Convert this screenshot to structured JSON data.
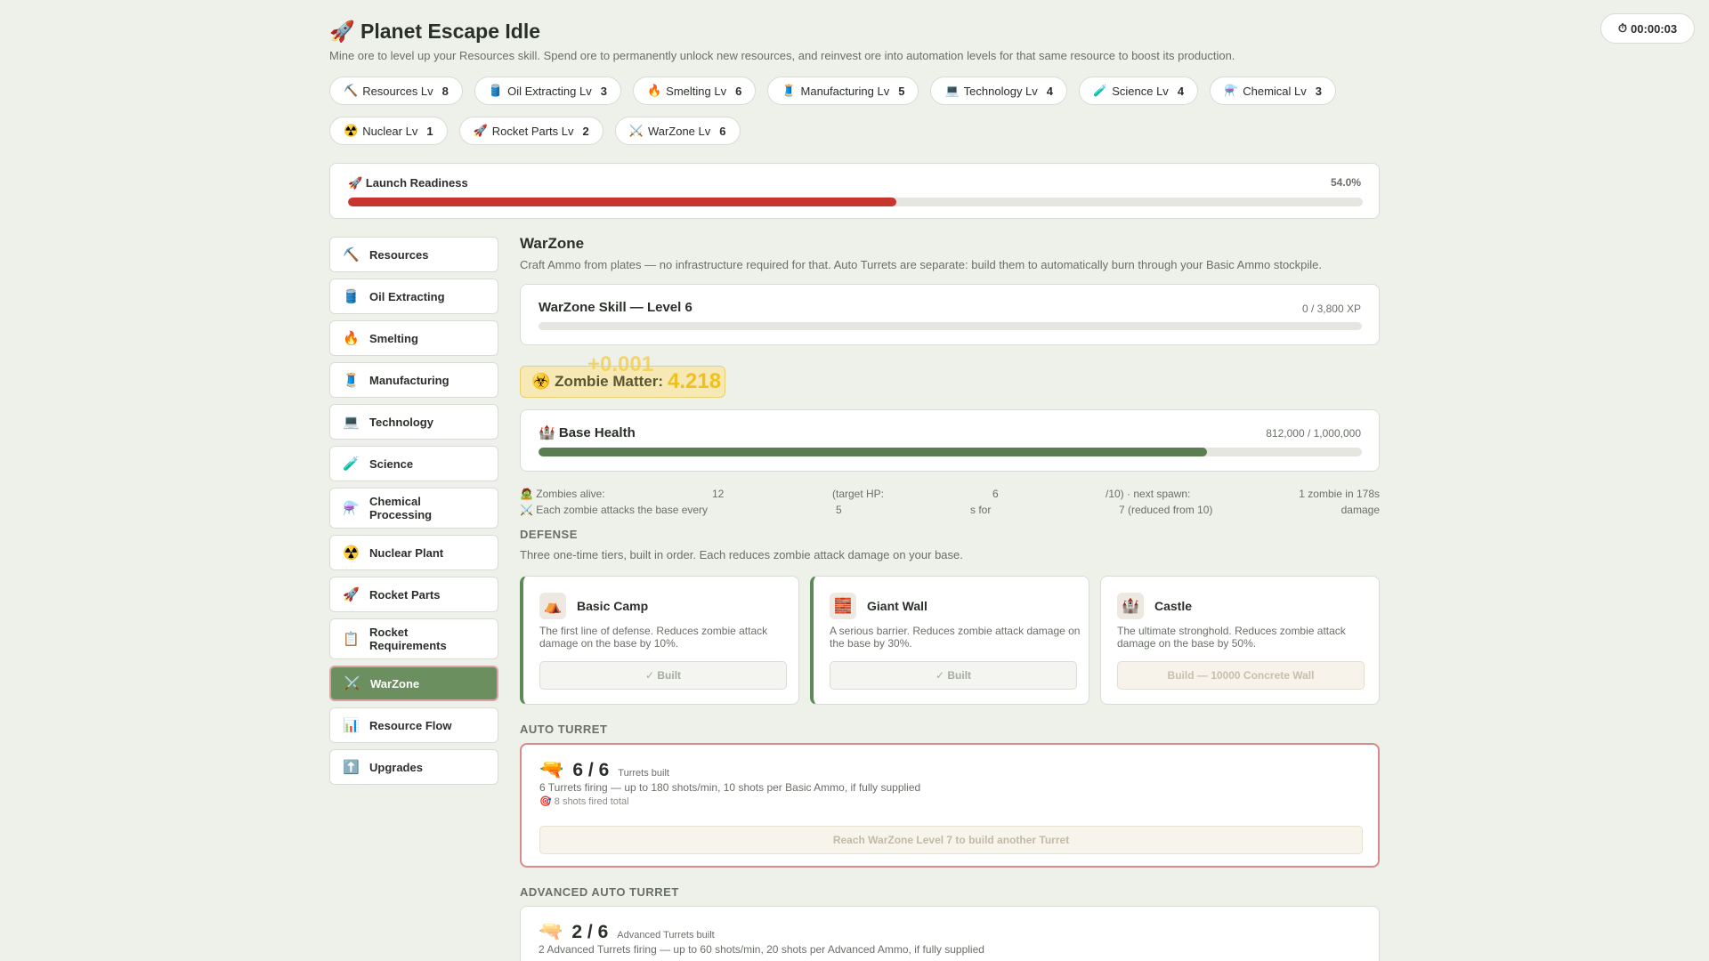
{
  "header": {
    "icon": "🚀",
    "title": "Planet Escape Idle",
    "subtitle": "Mine ore to level up your Resources skill. Spend ore to permanently unlock new resources, and reinvest ore into automation levels for that same resource to boost its production.",
    "timer_icon": "⏱",
    "timer": "00:00:03"
  },
  "skills": [
    {
      "icon": "⛏️",
      "label": "Resources Lv",
      "level": "8"
    },
    {
      "icon": "🛢️",
      "label": "Oil Extracting Lv",
      "level": "3"
    },
    {
      "icon": "🔥",
      "label": "Smelting Lv",
      "level": "6"
    },
    {
      "icon": "🧵",
      "label": "Manufacturing Lv",
      "level": "5"
    },
    {
      "icon": "💻",
      "label": "Technology Lv",
      "level": "4"
    },
    {
      "icon": "🧪",
      "label": "Science Lv",
      "level": "4"
    },
    {
      "icon": "⚗️",
      "label": "Chemical Lv",
      "level": "3"
    },
    {
      "icon": "☢️",
      "label": "Nuclear Lv",
      "level": "1"
    },
    {
      "icon": "🚀",
      "label": "Rocket Parts Lv",
      "level": "2"
    },
    {
      "icon": "⚔️",
      "label": "WarZone Lv",
      "level": "6"
    }
  ],
  "readiness": {
    "icon": "🚀",
    "label": "Launch Readiness",
    "percent_text": "54.0%",
    "value": 0.54,
    "color": "#c8352e"
  },
  "sidebar": [
    {
      "icon": "⛏️",
      "label": "Resources"
    },
    {
      "icon": "🛢️",
      "label": "Oil Extracting"
    },
    {
      "icon": "🔥",
      "label": "Smelting"
    },
    {
      "icon": "🧵",
      "label": "Manufacturing"
    },
    {
      "icon": "💻",
      "label": "Technology"
    },
    {
      "icon": "🧪",
      "label": "Science"
    },
    {
      "icon": "⚗️",
      "label": "Chemical Processing"
    },
    {
      "icon": "☢️",
      "label": "Nuclear Plant"
    },
    {
      "icon": "🚀",
      "label": "Rocket Parts"
    },
    {
      "icon": "📋",
      "label": "Rocket Requirements"
    },
    {
      "icon": "⚔️",
      "label": "WarZone",
      "active": true
    },
    {
      "icon": "📊",
      "label": "Resource Flow"
    },
    {
      "icon": "⬆️",
      "label": "Upgrades"
    }
  ],
  "warzone": {
    "title": "WarZone",
    "description": "Craft Ammo from plates — no infrastructure required for that. Auto Turrets are separate: build them to automatically burn through your Basic Ammo stockpile.",
    "skill_label": "WarZone Skill — Level 6",
    "skill_xp": "0 / 3,800 XP",
    "skill_progress": 0,
    "zombie_matter_icon": "☣️",
    "zombie_matter_label": "Zombie Matter:",
    "zombie_matter_value": "4.218",
    "zombie_matter_delta": "+0.001",
    "base_health_icon": "🏰",
    "base_health_label": "Base Health",
    "base_health_text": "812,000 / 1,000,000",
    "base_health_value": 0.812,
    "base_health_color": "#5a7d52",
    "stats_row1": [
      "🧟 Zombies alive:",
      "12",
      "(target HP:",
      "6",
      "/10) · next spawn:",
      "1 zombie in 178s"
    ],
    "stats_row2": [
      "⚔️ Each zombie attacks the base every",
      "5",
      "s for",
      "7 (reduced from 10)",
      "damage"
    ]
  },
  "defense": {
    "heading": "DEFENSE",
    "description": "Three one-time tiers, built in order. Each reduces zombie attack damage on your base.",
    "tiers": [
      {
        "icon": "⛺",
        "name": "Basic Camp",
        "desc": "The first line of defense. Reduces zombie attack damage on the base by 10%.",
        "button": "✓ Built",
        "built": true
      },
      {
        "icon": "🧱",
        "name": "Giant Wall",
        "desc": "A serious barrier. Reduces zombie attack damage on the base by 30%.",
        "button": "✓ Built",
        "built": true
      },
      {
        "icon": "🏰",
        "name": "Castle",
        "desc": "The ultimate stronghold. Reduces zombie attack damage on the base by 50%.",
        "button": "Build — 10000 Concrete Wall",
        "built": false
      }
    ]
  },
  "auto_turret": {
    "heading": "AUTO TURRET",
    "icon": "🔫",
    "count": "6 / 6",
    "count_label": "Turrets built",
    "line1": "6 Turrets firing — up to 180 shots/min, 10 shots per Basic Ammo, if fully supplied",
    "shots_icon": "🎯",
    "line2": "8 shots fired total",
    "button": "Reach WarZone Level 7 to build another Turret"
  },
  "advanced_turret": {
    "heading": "ADVANCED AUTO TURRET",
    "icon": "🔫",
    "count": "2 / 6",
    "count_label": "Advanced Turrets built",
    "line1": "2 Advanced Turrets firing — up to 60 shots/min, 20 shots per Advanced Ammo, if fully supplied"
  }
}
